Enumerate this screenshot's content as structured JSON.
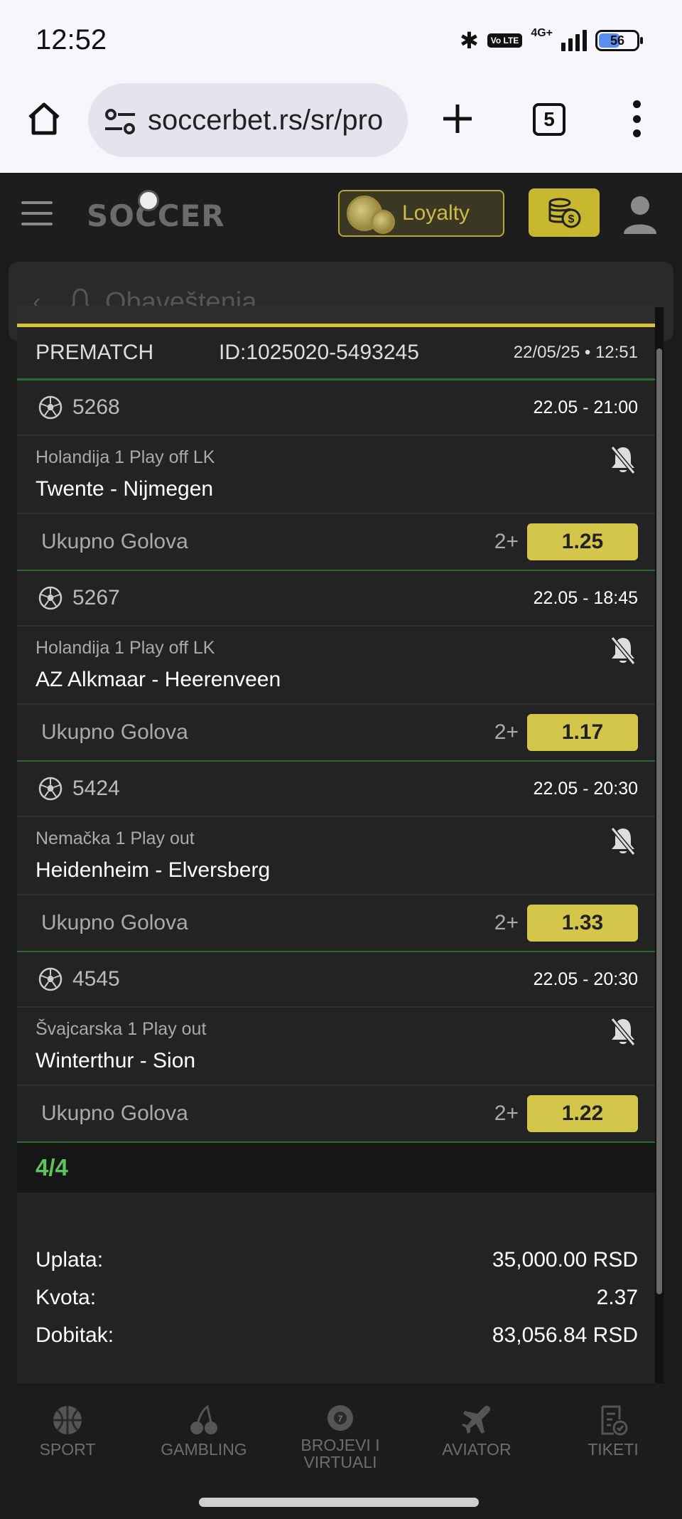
{
  "status_bar": {
    "time": "12:52",
    "battery": "56",
    "network": "4G+",
    "volte": "Vo LTE"
  },
  "browser": {
    "url": "soccerbet.rs/sr/pro",
    "tab_count": "5"
  },
  "site_header": {
    "logo": "SOCCER",
    "loyalty_label": "Loyalty"
  },
  "notifications_header": {
    "title": "Obaveštenja"
  },
  "ticket": {
    "type": "PREMATCH",
    "id": "ID:1025020-5493245",
    "created": "22/05/25 • 12:51",
    "matches": [
      {
        "code": "5268",
        "date": "22.05  -  21:00",
        "league": "Holandija 1 Play off LK",
        "teams": "Twente - Nijmegen",
        "market": "Ukupno Golova",
        "pick": "2+",
        "odd": "1.25"
      },
      {
        "code": "5267",
        "date": "22.05  -  18:45",
        "league": "Holandija 1 Play off LK",
        "teams": "AZ Alkmaar - Heerenveen",
        "market": "Ukupno Golova",
        "pick": "2+",
        "odd": "1.17"
      },
      {
        "code": "5424",
        "date": "22.05  -  20:30",
        "league": "Nemačka 1 Play out",
        "teams": "Heidenheim - Elversberg",
        "market": "Ukupno Golova",
        "pick": "2+",
        "odd": "1.33"
      },
      {
        "code": "4545",
        "date": "22.05  -  20:30",
        "league": "Švajcarska 1 Play out",
        "teams": "Winterthur - Sion",
        "market": "Ukupno Golova",
        "pick": "2+",
        "odd": "1.22"
      }
    ],
    "count": "4/4",
    "summary": {
      "stake_label": "Uplata:",
      "stake_value": "35,000.00 RSD",
      "odds_label": "Kvota:",
      "odds_value": "2.37",
      "win_label": "Dobitak:",
      "win_value": "83,056.84 RSD"
    }
  },
  "bottom_nav": [
    {
      "label": "SPORT",
      "icon": "basketball-icon"
    },
    {
      "label": "GAMBLING",
      "icon": "cherries-icon"
    },
    {
      "label": "BROJEVI I VIRTUALI",
      "icon": "lottery-ball-icon"
    },
    {
      "label": "AVIATOR",
      "icon": "airplane-icon"
    },
    {
      "label": "TIKETI",
      "icon": "ticket-icon"
    }
  ],
  "colors": {
    "accent": "#d4c64a",
    "success": "#5ec35a",
    "panel": "#232323",
    "divider_green": "#2e6b34"
  }
}
